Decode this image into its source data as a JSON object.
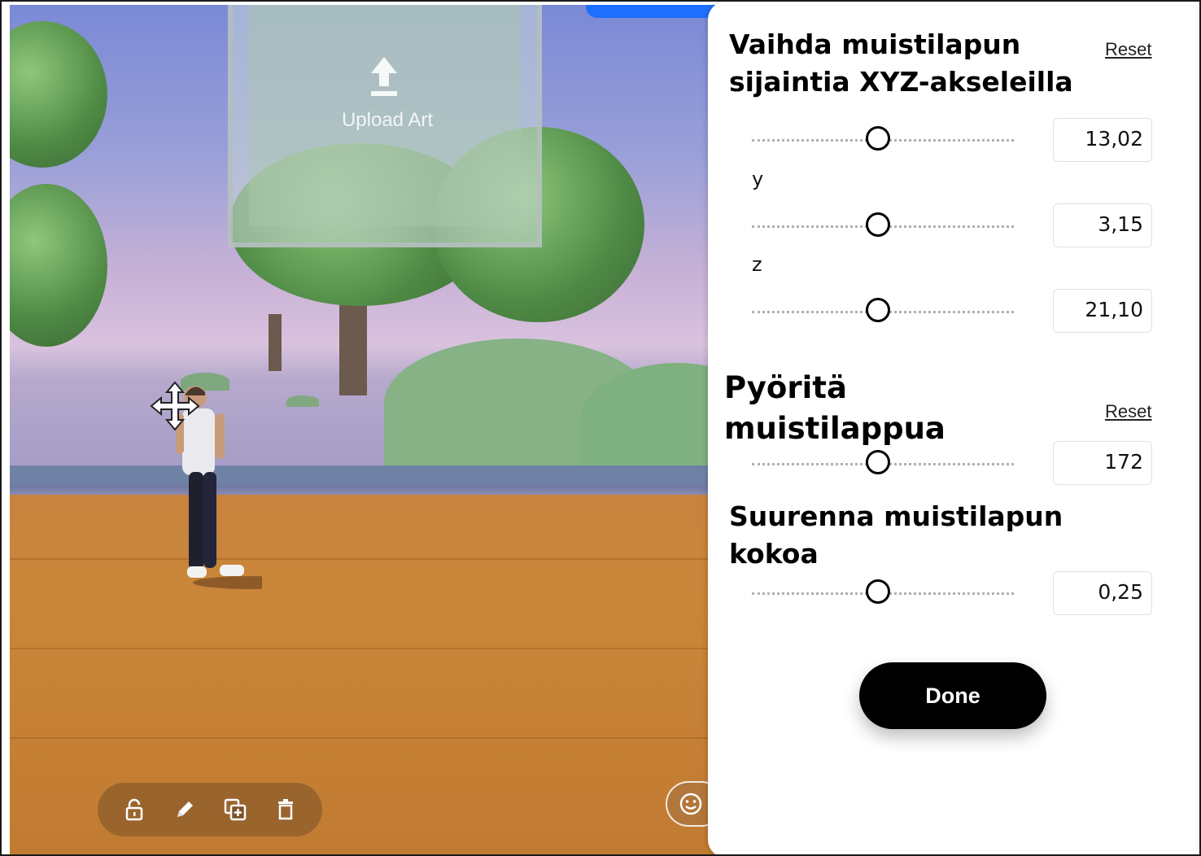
{
  "scene": {
    "upload_label": "Upload Art",
    "toolbar": {
      "icons": [
        "lock-icon",
        "pencil-icon",
        "duplicate-icon",
        "trash-icon"
      ]
    },
    "emoji_icon": "smile-icon"
  },
  "panel": {
    "position": {
      "title": "Vaihda muistilapun sijaintia XYZ-akseleilla",
      "reset_label": "Reset",
      "x": {
        "label": "",
        "value": "13,02"
      },
      "y": {
        "label": "y",
        "value": "3,15"
      },
      "z": {
        "label": "z",
        "value": "21,10"
      }
    },
    "rotation": {
      "title": "Pyöritä muistilappua",
      "reset_label": "Reset",
      "value": "172"
    },
    "scale": {
      "title": "Suurenna muistilapun kokoa",
      "value": "0,25"
    },
    "done_label": "Done"
  },
  "colors": {
    "accent_blue": "#1f6fff",
    "done_button": "#000000",
    "floor": "#c98639"
  }
}
